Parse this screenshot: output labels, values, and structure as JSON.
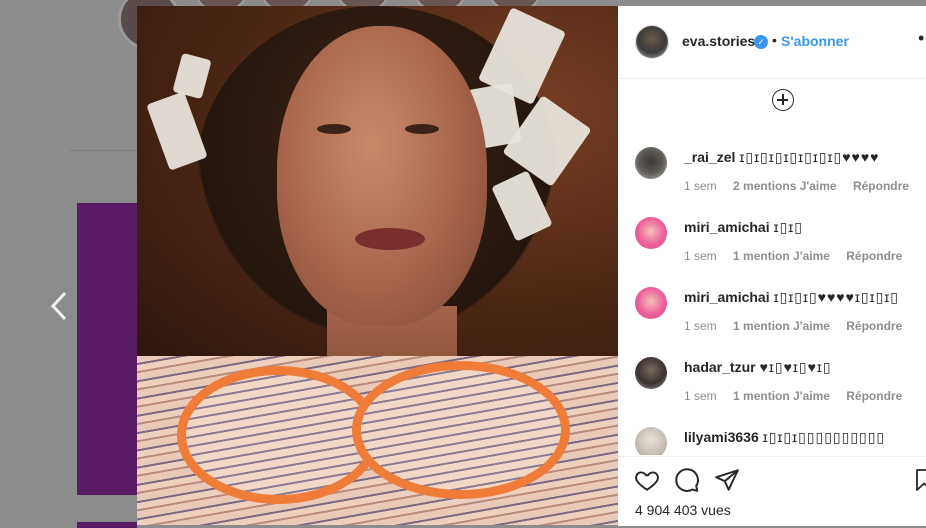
{
  "post": {
    "username": "eva.stories",
    "separator": "•",
    "follow_label": "S'abonner",
    "more_icon": "more-options-icon",
    "views": "4 904 403 vues"
  },
  "comments": [
    {
      "user": "_rai_zel",
      "text": "ɪ▯ɪ▯ɪ▯ɪ▯ɪ▯ɪ▯ɪ▯♥♥♥♥",
      "time": "1 sem",
      "likes": "2 mentions J'aime",
      "reply": "Répondre"
    },
    {
      "user": "miri_amichai",
      "text": "ɪ▯ɪ▯",
      "time": "1 sem",
      "likes": "1 mention J'aime",
      "reply": "Répondre"
    },
    {
      "user": "miri_amichai",
      "text": "ɪ▯ɪ▯ɪ▯♥♥♥♥ɪ▯ɪ▯ɪ▯",
      "time": "1 sem",
      "likes": "1 mention J'aime",
      "reply": "Répondre"
    },
    {
      "user": "hadar_tzur",
      "text": "♥ɪ▯♥ɪ▯♥ɪ▯",
      "time": "1 sem",
      "likes": "1 mention J'aime",
      "reply": "Répondre"
    },
    {
      "user": "lilyami3636",
      "text": "ɪ▯ɪ▯ɪ▯▯▯▯▯▯▯▯▯▯",
      "time": "",
      "likes": "",
      "reply": ""
    }
  ],
  "icons": {
    "prev": "chevron-left-icon",
    "add": "plus-circle-icon",
    "like": "heart-icon",
    "comment": "comment-icon",
    "share": "share-icon",
    "save": "bookmark-icon",
    "verified": "verified-badge-icon"
  },
  "colors": {
    "accent": "#3897f0",
    "text": "#262626",
    "muted": "#8e8e8e"
  }
}
